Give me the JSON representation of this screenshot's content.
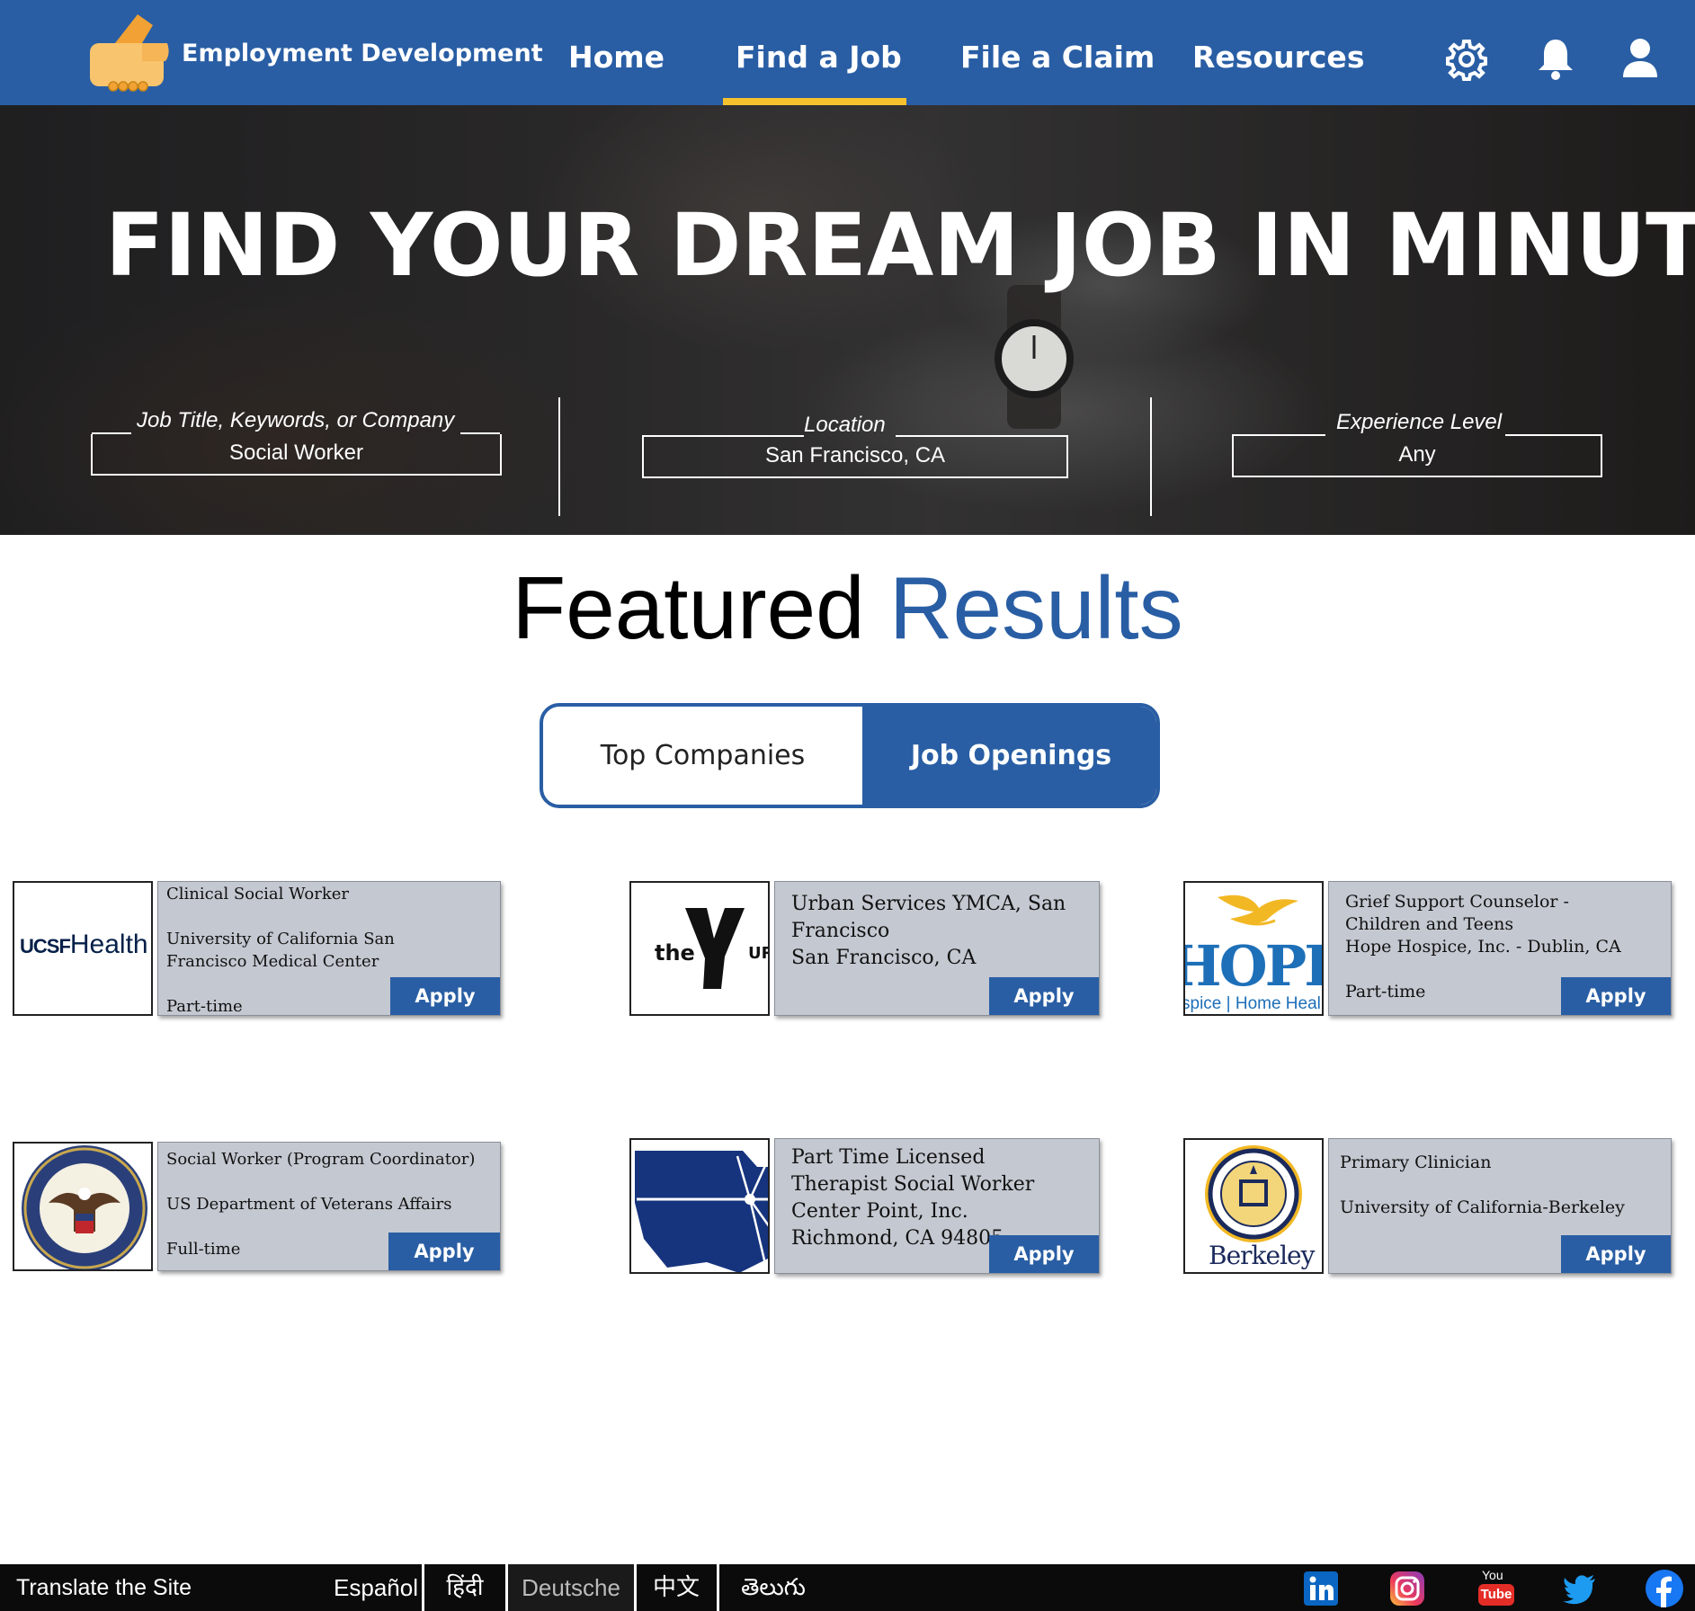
{
  "header": {
    "brand": "Employment Development",
    "nav": [
      "Home",
      "Find a Job",
      "File a Claim",
      "Resources"
    ],
    "active_nav": "Find a Job",
    "icons": [
      "gear-icon",
      "bell-icon",
      "user-icon"
    ],
    "colors": {
      "bar": "#295ea4",
      "active_underline": "#f6c12e"
    }
  },
  "hero": {
    "title": "FIND YOUR DREAM JOB IN MINUTES",
    "search": {
      "keywords_label": "Job Title, Keywords, or Company",
      "keywords_value": "Social Worker",
      "location_label": "Location",
      "location_value": "San Francisco, CA",
      "experience_label": "Experience Level",
      "experience_value": "Any"
    }
  },
  "featured": {
    "title_part1": "Featured",
    "title_part2": "Results",
    "tabs": [
      "Top Companies",
      "Job Openings"
    ],
    "active_tab": "Job Openings"
  },
  "jobs": [
    {
      "logo": "UCSF Health",
      "lines": [
        "Clinical Social Worker",
        "",
        "University of California San",
        "Francisco Medical Center",
        "",
        "Part-time"
      ],
      "apply": "Apply"
    },
    {
      "logo": "the YMCA",
      "lines": [
        "Urban Services YMCA, San",
        "Francisco",
        "San Francisco, CA"
      ],
      "apply": "Apply"
    },
    {
      "logo": "HOPE Hospice | Home Health",
      "lines": [
        "Grief Support Counselor -",
        "Children and Teens",
        "Hope Hospice, Inc. - Dublin, CA",
        "",
        "Part-time"
      ],
      "apply": "Apply"
    },
    {
      "logo": "Department of Veterans Affairs seal",
      "lines": [
        "Social Worker (Program Coordinator)",
        "",
        "US Department  of Veterans Affairs",
        "",
        "Full-time"
      ],
      "apply": "Apply"
    },
    {
      "logo": "Center Point logo",
      "lines": [
        "Part Time Licensed",
        "Therapist Social Worker",
        "Center Point, Inc.",
        "Richmond, CA 94805"
      ],
      "apply": "Apply"
    },
    {
      "logo": "Berkeley seal",
      "lines": [
        "Primary Clinician",
        "",
        "University of California-Berkeley"
      ],
      "apply": "Apply"
    }
  ],
  "logo_text": {
    "ucsf_prefix": "UCSF",
    "ucsf_word": "Health",
    "ymca_the": "the",
    "ymca_tail": "UR",
    "hope": "HOPE",
    "hope_tag": "spice | Home Heal",
    "berkeley": "Berkeley"
  },
  "footer": {
    "translate_label": "Translate the Site",
    "languages": [
      "Español",
      "हिंदी",
      "Deutsche",
      "中文",
      "తెలుగు"
    ],
    "social": [
      "linkedin-icon",
      "instagram-icon",
      "youtube-icon",
      "twitter-icon",
      "facebook-icon"
    ],
    "youtube_you": "You",
    "youtube_tube": "Tube"
  }
}
